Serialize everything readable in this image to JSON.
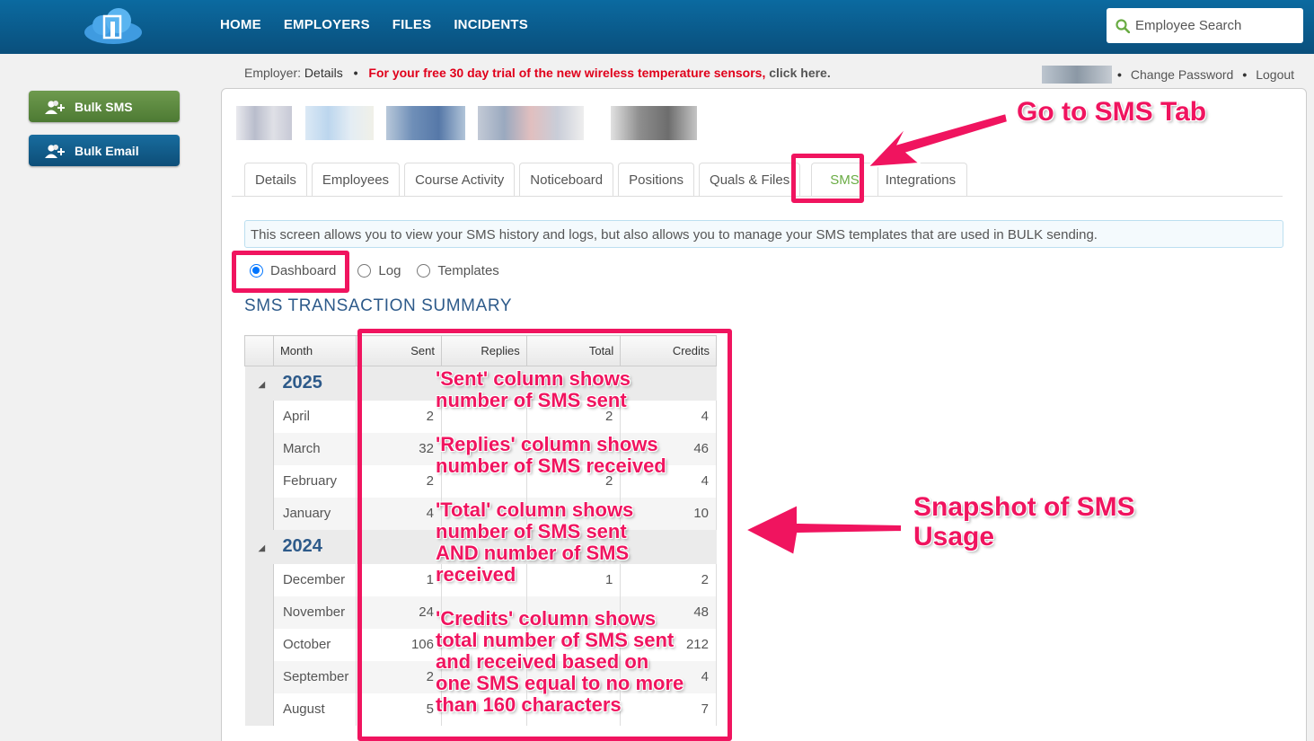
{
  "nav": {
    "items": [
      "HOME",
      "EMPLOYERS",
      "FILES",
      "INCIDENTS"
    ]
  },
  "search": {
    "placeholder": "Employee Search",
    "icon": "search-icon"
  },
  "sidebar": {
    "bulk_sms": "Bulk SMS",
    "bulk_email": "Bulk Email"
  },
  "infobar": {
    "employer_label": "Employer:",
    "employer_value": "Details",
    "dot": "•",
    "promo": "For your free 30 day trial of the new wireless temperature sensors,",
    "promo_link": "click here."
  },
  "account": {
    "change_password": "Change Password",
    "logout": "Logout"
  },
  "tabs": [
    "Details",
    "Employees",
    "Course Activity",
    "Noticeboard",
    "Positions",
    "Quals & Files",
    "SMS",
    "Integrations"
  ],
  "active_tab": "SMS",
  "notice": "This screen allows you to view your SMS history and logs, but also allows you to manage your SMS templates that are used in BULK sending.",
  "view_options": {
    "dashboard": "Dashboard",
    "log": "Log",
    "templates": "Templates",
    "selected": "Dashboard"
  },
  "summary": {
    "title": "SMS TRANSACTION SUMMARY",
    "columns": [
      "Month",
      "Sent",
      "Replies",
      "Total",
      "Credits"
    ],
    "years": [
      {
        "year": "2025",
        "rows": [
          {
            "month": "April",
            "sent": "2",
            "replies": "",
            "total": "2",
            "credits": "4"
          },
          {
            "month": "March",
            "sent": "32",
            "replies": "",
            "total": "",
            "credits": "46"
          },
          {
            "month": "February",
            "sent": "2",
            "replies": "",
            "total": "2",
            "credits": "4"
          },
          {
            "month": "January",
            "sent": "4",
            "replies": "",
            "total": "",
            "credits": "10"
          }
        ]
      },
      {
        "year": "2024",
        "rows": [
          {
            "month": "December",
            "sent": "1",
            "replies": "",
            "total": "1",
            "credits": "2"
          },
          {
            "month": "November",
            "sent": "24",
            "replies": "",
            "total": "",
            "credits": "48"
          },
          {
            "month": "October",
            "sent": "106",
            "replies": "",
            "total": "",
            "credits": "212"
          },
          {
            "month": "September",
            "sent": "2",
            "replies": "",
            "total": "",
            "credits": "4"
          },
          {
            "month": "August",
            "sent": "5",
            "replies": "",
            "total": "",
            "credits": "7"
          }
        ]
      }
    ]
  },
  "annotations": {
    "go_to_sms": "Go to SMS Tab",
    "snapshot": [
      "Snapshot of SMS",
      "Usage"
    ],
    "sent_note": [
      "'Sent' column shows",
      "number of SMS sent"
    ],
    "replies_note": [
      "'Replies' column shows",
      "number of SMS received"
    ],
    "total_note": [
      "'Total' column shows",
      "number of SMS sent",
      "AND number of SMS",
      "received"
    ],
    "credits_note": [
      "'Credits' column shows",
      "total number of SMS sent",
      "and received based on",
      "one SMS equal to no more",
      "than 160 characters"
    ]
  },
  "colors": {
    "annotation": "#f0145f",
    "nav_bg": "#0a5a8c",
    "active_tab": "#6aac44"
  }
}
